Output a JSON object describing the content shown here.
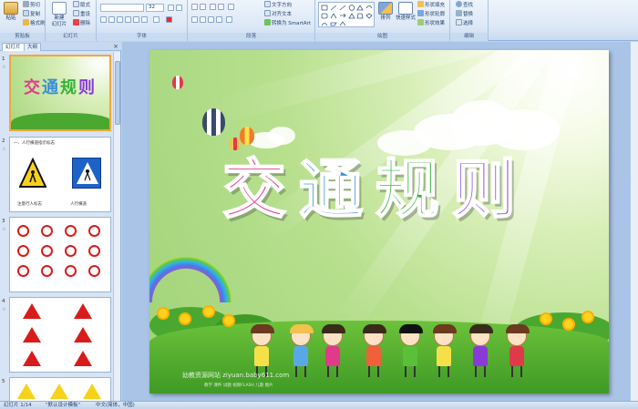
{
  "ribbon": {
    "clipboard": {
      "paste": "粘贴",
      "cut": "剪切",
      "copy": "复制",
      "format_painter": "格式刷",
      "group_label": "剪贴板"
    },
    "slides": {
      "new_slide": "新建\n幻灯片",
      "layout": "版式",
      "reset": "重设",
      "delete": "删除",
      "group_label": "幻灯片"
    },
    "font": {
      "font_name": "",
      "font_size": "32",
      "group_label": "字体"
    },
    "paragraph": {
      "text_direction": "文字方向",
      "align_text": "对齐文本",
      "smartart": "转换为 SmartArt",
      "group_label": "段落"
    },
    "drawing": {
      "arrange": "排列",
      "quick_styles": "快速样式",
      "shape_fill": "形状填充",
      "shape_outline": "形状轮廓",
      "shape_effects": "形状效果",
      "group_label": "绘图"
    },
    "editing": {
      "find": "查找",
      "replace": "替换",
      "select": "选择",
      "group_label": "编辑"
    }
  },
  "pane": {
    "tab_slides": "幻灯片",
    "tab_outline": "大纲",
    "close": "×",
    "thumbs": [
      {
        "num": "1"
      },
      {
        "num": "2",
        "caption": "一、人行横道指示标志",
        "label_left": "注意行人标志",
        "label_right": "人行横道"
      },
      {
        "num": "3"
      },
      {
        "num": "4"
      },
      {
        "num": "5"
      }
    ]
  },
  "slide": {
    "title_chars": [
      "交",
      "通",
      "规",
      "则"
    ],
    "title_colors": [
      "#e23a8a",
      "#3a8fd8",
      "#36b13a",
      "#8a3ad8"
    ],
    "watermark": "幼教资源网站  ziyuan.baby611.com",
    "watermark_small": "教学 课件 试题 视频FLASH 儿歌 图片"
  },
  "status": {
    "slide_info": "幻灯片 1/14",
    "theme": "\"默认设计模板\"",
    "language": "中文(简体，中国)"
  }
}
